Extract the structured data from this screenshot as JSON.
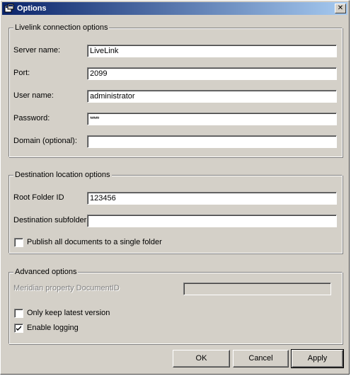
{
  "window": {
    "title": "Options",
    "close_symbol": "✕"
  },
  "livelink": {
    "legend": "Livelink connection options",
    "server_name": {
      "label": "Server name:",
      "value": "LiveLink"
    },
    "port": {
      "label": "Port:",
      "value": "2099"
    },
    "user_name": {
      "label": "User name:",
      "value": "administrator"
    },
    "password": {
      "label": "Password:",
      "value": "*****"
    },
    "domain": {
      "label": "Domain (optional):",
      "value": ""
    }
  },
  "destination": {
    "legend": "Destination location options",
    "root_folder_id": {
      "label": "Root Folder ID",
      "value": "123456"
    },
    "destination_subfolder": {
      "label": "Destination subfolder:",
      "value": ""
    },
    "publish_single_folder": {
      "label": "Publish all documents to a single folder",
      "checked": false
    }
  },
  "advanced": {
    "legend": "Advanced options",
    "meridian_property": {
      "label": "Meridian property DocumentID",
      "value": "",
      "disabled": true
    },
    "only_keep_latest": {
      "label": "Only keep latest version",
      "checked": false
    },
    "enable_logging": {
      "label": "Enable logging",
      "checked": true
    }
  },
  "buttons": {
    "ok": "OK",
    "cancel": "Cancel",
    "apply": "Apply"
  },
  "icons": {
    "title": "options-window-icon",
    "close": "close-icon",
    "check": "checkmark-icon"
  }
}
